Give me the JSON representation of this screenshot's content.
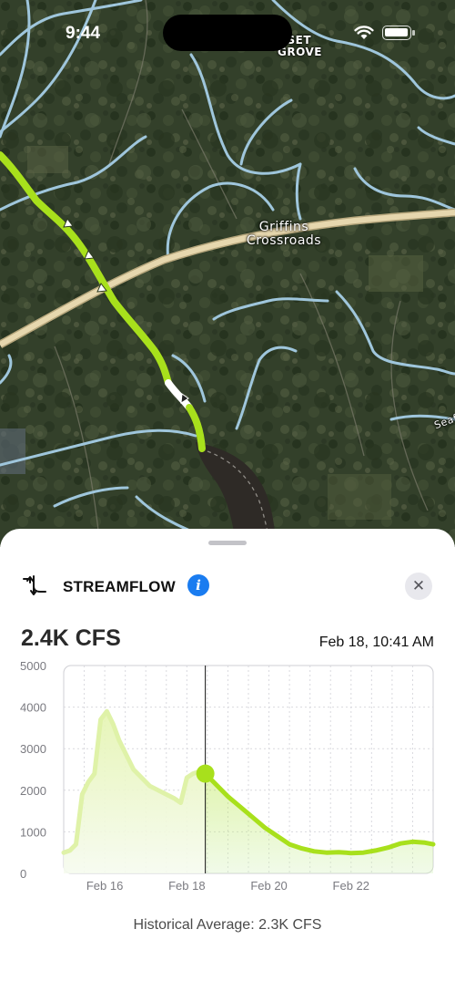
{
  "status_bar": {
    "time": "9:44",
    "wifi_icon": "wifi-icon",
    "battery_icon": "battery-icon"
  },
  "map": {
    "labels": {
      "sunset_grove": "NSET\nGROVE",
      "griffins_crossroads": "Griffins\nCrossroads",
      "seaf": "Seaf"
    },
    "colors": {
      "river_highlight": "#a8e01c",
      "river_selected": "#ffffff",
      "waterways": "#9fc6dc",
      "road": "#e6d7ae",
      "lake": "#2e2a26"
    }
  },
  "sheet": {
    "title": "STREAMFLOW",
    "stream_icon": "streamflow-icon",
    "info_icon": "info-icon",
    "close_label": "✕",
    "current_value": "2.4K CFS",
    "current_time": "Feb 18, 10:41 AM",
    "historical_average": "Historical Average: 2.3K CFS"
  },
  "chart_data": {
    "type": "area",
    "title": "",
    "xlabel": "",
    "ylabel": "",
    "ylim": [
      0,
      5000
    ],
    "yticks": [
      "5000",
      "4000",
      "3000",
      "2000",
      "1000",
      "0"
    ],
    "ytick_values": [
      5000,
      4000,
      3000,
      2000,
      1000,
      0
    ],
    "xticks": [
      "Feb 16",
      "Feb 18",
      "Feb 20",
      "Feb 22"
    ],
    "xtick_days": [
      16,
      18,
      20,
      22
    ],
    "xlim_days": [
      15,
      24
    ],
    "grid": true,
    "selected_day": 18.45,
    "selected_value": 2400,
    "accent_color": "#a8e01c",
    "series": [
      {
        "x_days": [
          15.0,
          15.15,
          15.3,
          15.45,
          15.6,
          15.75,
          15.9,
          16.05,
          16.2,
          16.35,
          16.5,
          16.7,
          16.9,
          17.1,
          17.3,
          17.5,
          17.7,
          17.85,
          18.0,
          18.15,
          18.3,
          18.45
        ],
        "values": [
          500,
          550,
          700,
          1900,
          2200,
          2400,
          3700,
          3900,
          3600,
          3200,
          2900,
          2500,
          2300,
          2100,
          2000,
          1900,
          1800,
          1700,
          2300,
          2400,
          2450,
          2400
        ]
      },
      {
        "x_days": [
          18.45,
          18.7,
          19.0,
          19.3,
          19.6,
          19.9,
          20.2,
          20.5,
          20.8,
          21.1,
          21.4,
          21.7,
          22.0,
          22.3,
          22.6,
          22.9,
          23.2,
          23.5,
          23.8,
          24.0
        ],
        "values": [
          2400,
          2150,
          1850,
          1600,
          1350,
          1100,
          900,
          700,
          600,
          530,
          500,
          510,
          490,
          500,
          550,
          620,
          720,
          760,
          740,
          700
        ]
      }
    ]
  }
}
